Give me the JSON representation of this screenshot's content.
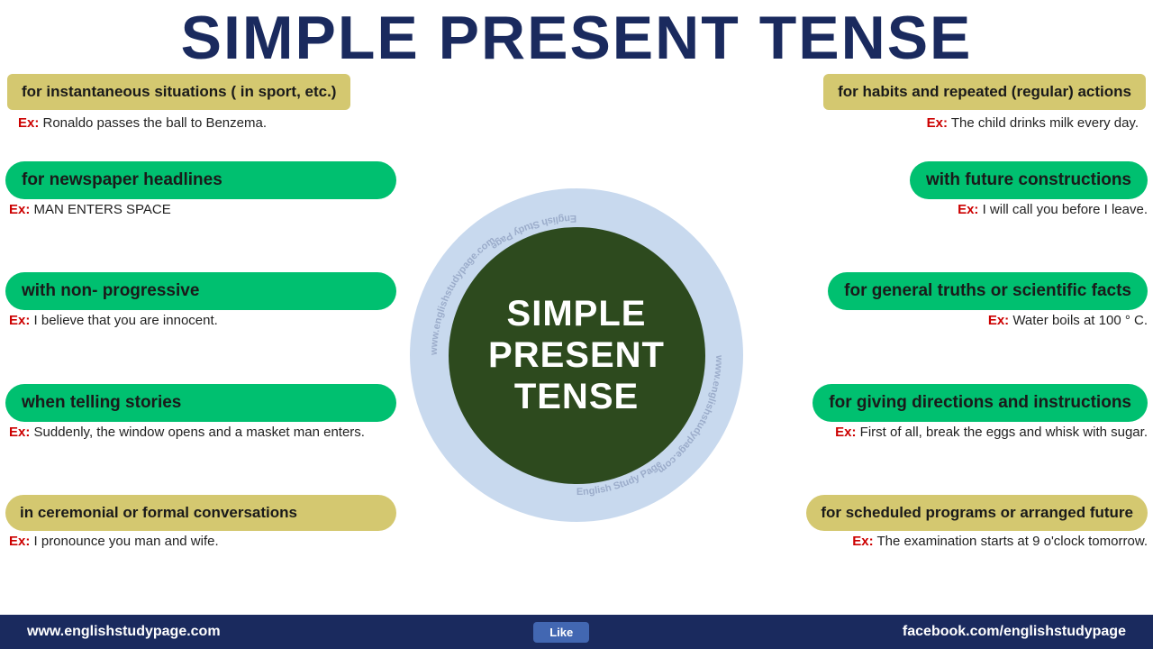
{
  "title": "SIMPLE PRESENT TENSE",
  "center": {
    "line1": "SIMPLE",
    "line2": "PRESENT",
    "line3": "TENSE"
  },
  "top_left": {
    "label": "for instantaneous situations ( in sport, etc.)",
    "example_label": "Ex:",
    "example_text": " Ronaldo passes the ball to Benzema."
  },
  "top_right": {
    "label": "for habits and  repeated (regular) actions",
    "example_label": "Ex:",
    "example_text": " The child drinks milk every day."
  },
  "row1_left": {
    "label": "for newspaper headlines",
    "example_label": "Ex:",
    "example_text": " MAN ENTERS SPACE"
  },
  "row1_right": {
    "label": "with future constructions",
    "example_label": "Ex:",
    "example_text": " I will call you before I leave."
  },
  "row2_left": {
    "label": "with non- progressive",
    "example_label": "Ex:",
    "example_text": " I believe that you are innocent."
  },
  "row2_right": {
    "label": "for general truths or scientific facts",
    "example_label": "Ex:",
    "example_text": " Water boils at 100 ° C."
  },
  "row3_left": {
    "label": "when telling stories",
    "example_label": "Ex:",
    "example_text": " Suddenly, the window opens and a masket man enters."
  },
  "row3_right": {
    "label": "for giving directions and instructions",
    "example_label": "Ex:",
    "example_text": " First of all, break the eggs and whisk with sugar."
  },
  "row4_left": {
    "label": "in ceremonial or formal conversations",
    "example_label": "Ex:",
    "example_text": " I pronounce you man and wife."
  },
  "row4_right": {
    "label": "for scheduled programs or arranged future",
    "example_label": "Ex:",
    "example_text": " The examination starts at 9 o'clock tomorrow."
  },
  "footer": {
    "left": "www.englishstudypage.com",
    "like": "Like",
    "right": "facebook.com/englishstudypage"
  }
}
